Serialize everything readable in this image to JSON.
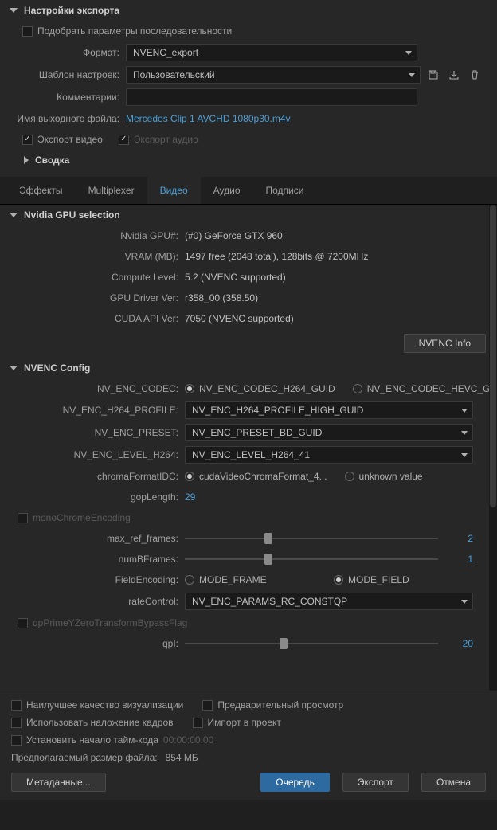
{
  "export_settings": {
    "title": "Настройки экспорта",
    "match_sequence": "Подобрать параметры последовательности",
    "format_label": "Формат:",
    "format_value": "NVENC_export",
    "preset_label": "Шаблон настроек:",
    "preset_value": "Пользовательский",
    "comments_label": "Комментарии:",
    "output_label": "Имя выходного файла:",
    "output_file": "Mercedes Clip 1 AVCHD 1080p30.m4v",
    "export_video": "Экспорт видео",
    "export_audio": "Экспорт аудио",
    "summary": "Сводка"
  },
  "tabs": {
    "effects": "Эффекты",
    "multiplexer": "Multiplexer",
    "video": "Видео",
    "audio": "Аудио",
    "captions": "Подписи"
  },
  "gpu": {
    "title": "Nvidia GPU selection",
    "gpu_num_label": "Nvidia GPU#:",
    "gpu_num": "(#0) GeForce GTX 960",
    "vram_label": "VRAM (MB):",
    "vram": "1497 free (2048 total), 128bits @ 7200MHz",
    "compute_label": "Compute Level:",
    "compute": "5.2 (NVENC supported)",
    "driver_label": "GPU Driver Ver:",
    "driver": "r358_00  (358.50)",
    "cuda_label": "CUDA API Ver:",
    "cuda": "7050 (NVENC supported)",
    "info_btn": "NVENC Info"
  },
  "nvenc": {
    "title": "NVENC Config",
    "codec_label": "NV_ENC_CODEC:",
    "codec_h264": "NV_ENC_CODEC_H264_GUID",
    "codec_hevc": "NV_ENC_CODEC_HEVC_GUID",
    "profile_label": "NV_ENC_H264_PROFILE:",
    "profile": "NV_ENC_H264_PROFILE_HIGH_GUID",
    "preset_label": "NV_ENC_PRESET:",
    "preset": "NV_ENC_PRESET_BD_GUID",
    "level_label": "NV_ENC_LEVEL_H264:",
    "level": "NV_ENC_LEVEL_H264_41",
    "chroma_label": "chromaFormatIDC:",
    "chroma_opt1": "cudaVideoChromaFormat_4...",
    "chroma_opt2": "unknown value",
    "gop_label": "gopLength:",
    "gop": "29",
    "mono": "monoChromeEncoding",
    "maxref_label": "max_ref_frames:",
    "maxref": "2",
    "numb_label": "numBFrames:",
    "numb": "1",
    "field_label": "FieldEncoding:",
    "field_frame": "MODE_FRAME",
    "field_field": "MODE_FIELD",
    "rate_label": "rateControl:",
    "rate": "NV_ENC_PARAMS_RC_CONSTQP",
    "qp_flag": "qpPrimeYZeroTransformBypassFlag",
    "qpi_label": "qpI:",
    "qpi": "20"
  },
  "bottom": {
    "best_quality": "Наилучшее качество визуализации",
    "preview": "Предварительный просмотр",
    "overlay": "Использовать наложение кадров",
    "import": "Импорт в проект",
    "timecode": "Установить начало тайм-кода",
    "timecode_val": "00:00:00:00",
    "filesize_label": "Предполагаемый размер файла:",
    "filesize": "854 МБ",
    "metadata": "Метаданные...",
    "queue": "Очередь",
    "export": "Экспорт",
    "cancel": "Отмена"
  }
}
